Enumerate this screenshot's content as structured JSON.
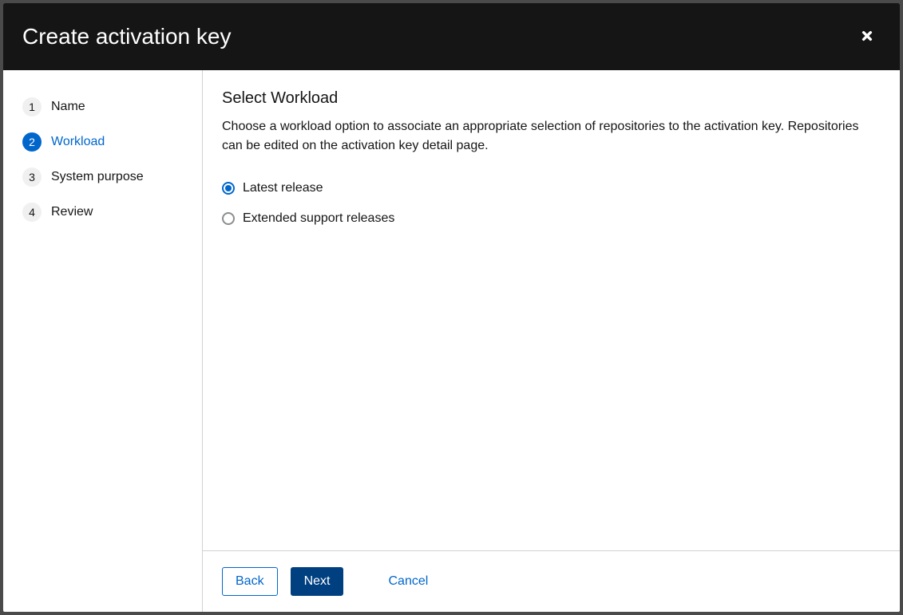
{
  "header": {
    "title": "Create activation key"
  },
  "sidebar": {
    "steps": [
      {
        "number": "1",
        "label": "Name",
        "active": false
      },
      {
        "number": "2",
        "label": "Workload",
        "active": true
      },
      {
        "number": "3",
        "label": "System purpose",
        "active": false
      },
      {
        "number": "4",
        "label": "Review",
        "active": false
      }
    ]
  },
  "content": {
    "title": "Select Workload",
    "description": "Choose a workload option to associate an appropriate selection of repositories to the activation key. Repositories can be edited on the activation key detail page.",
    "options": [
      {
        "label": "Latest release",
        "selected": true
      },
      {
        "label": "Extended support releases",
        "selected": false
      }
    ]
  },
  "footer": {
    "back": "Back",
    "next": "Next",
    "cancel": "Cancel"
  }
}
